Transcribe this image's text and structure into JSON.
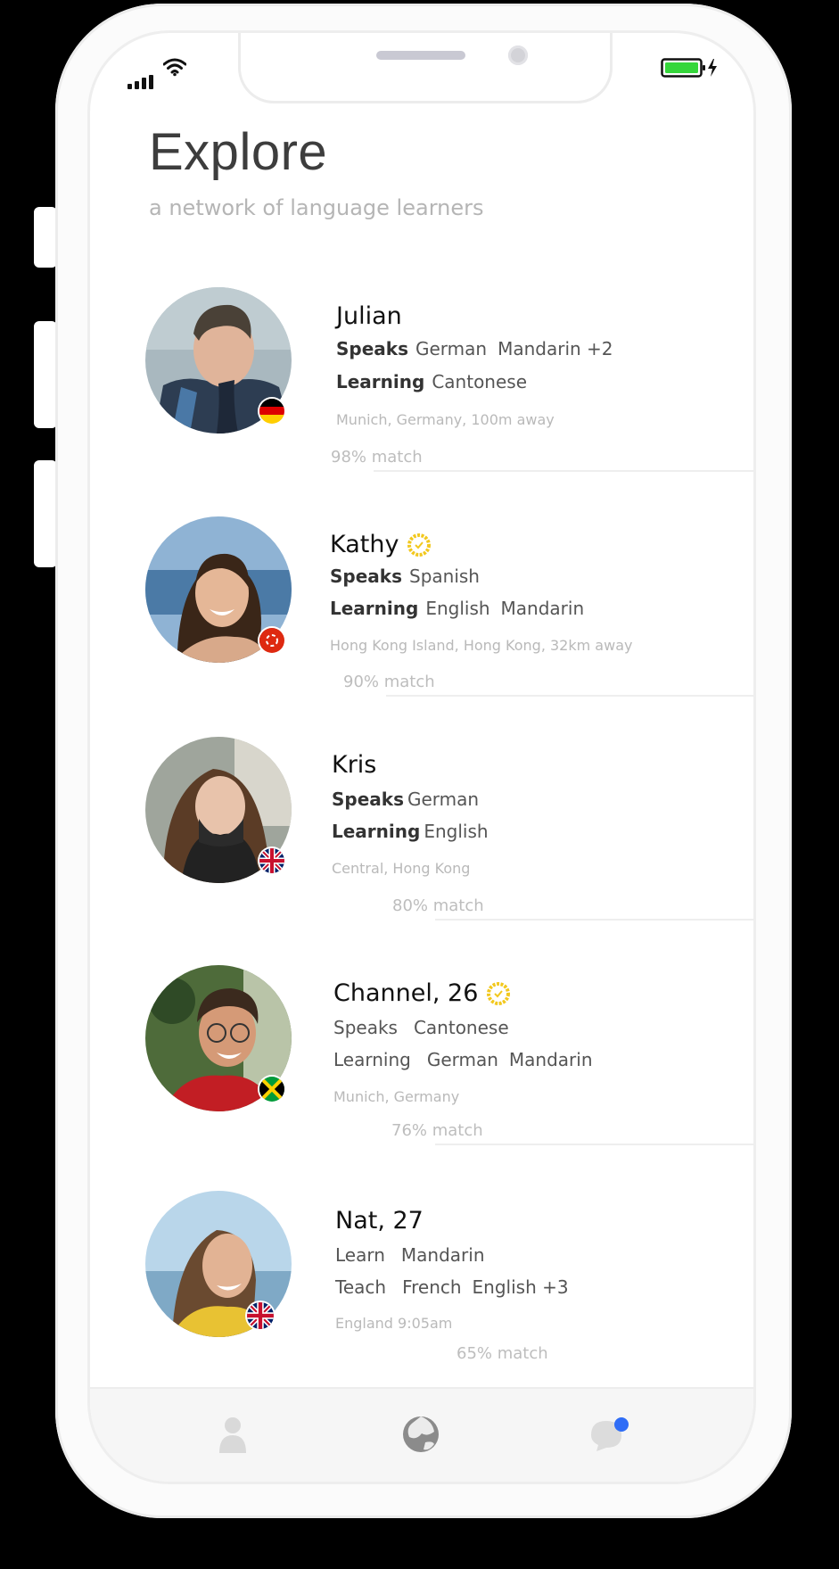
{
  "status_bar": {
    "signal_icon": "signal-bars-icon",
    "wifi_icon": "wifi-icon",
    "battery_icon": "battery-charging-icon"
  },
  "header": {
    "title": "Explore",
    "subtitle": "a network of language learners"
  },
  "colors": {
    "accent": "#2f6df6",
    "verified": "#f2c81e",
    "battery": "#35d63b"
  },
  "profiles": [
    {
      "name": "Julian",
      "verified": false,
      "speaks_label": "Speaks",
      "speaks": [
        "German",
        "Mandarin +2"
      ],
      "learning_label": "Learning",
      "learning": [
        "Cantonese"
      ],
      "location": "Munich, Germany, 100m away",
      "match": "98% match",
      "flag": "germany-flag-icon"
    },
    {
      "name": "Kathy",
      "verified": true,
      "speaks_label": "Speaks",
      "speaks": [
        "Spanish"
      ],
      "learning_label": "Learning",
      "learning": [
        "English",
        "Mandarin"
      ],
      "location": "Hong Kong Island, Hong Kong, 32km away",
      "match": "90% match",
      "flag": "hong-kong-flag-icon"
    },
    {
      "name": "Kris",
      "verified": false,
      "speaks_label": "Speaks",
      "speaks": [
        "German"
      ],
      "learning_label": "Learning",
      "learning": [
        "English"
      ],
      "location": "Central, Hong Kong",
      "match": "80% match",
      "flag": "uk-flag-icon"
    },
    {
      "name": "Channel, 26",
      "verified": true,
      "speaks_label": "Speaks",
      "speaks": [
        "Cantonese"
      ],
      "learning_label": "Learning",
      "learning": [
        "German",
        "Mandarin"
      ],
      "location": "Munich, Germany",
      "match": "76% match",
      "flag": "jamaica-flag-icon"
    },
    {
      "name": "Nat, 27",
      "verified": false,
      "speaks_label": "Learn",
      "speaks": [
        "Mandarin"
      ],
      "learning_label": "Teach",
      "learning": [
        "French",
        "English +3"
      ],
      "location": "England 9:05am",
      "match": "65% match",
      "flag": "uk-flag-icon"
    }
  ],
  "tabbar": [
    {
      "icon": "profile-icon"
    },
    {
      "icon": "globe-icon"
    },
    {
      "icon": "chat-bubble-icon",
      "has_notification": true
    }
  ]
}
